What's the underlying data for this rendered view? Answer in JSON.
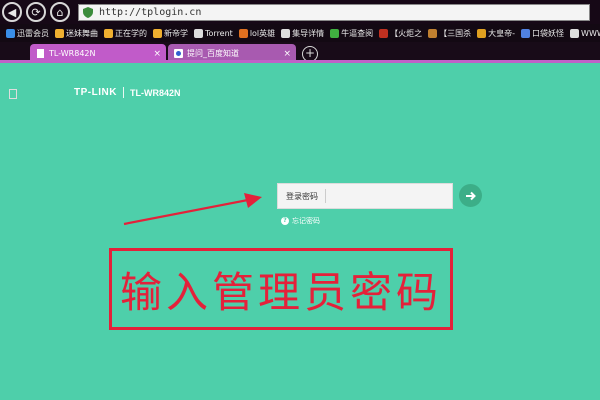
{
  "browser": {
    "url": "http://tplogin.cn",
    "bookmarks": [
      {
        "label": "迅雷会员",
        "color": "#3a8ee8"
      },
      {
        "label": "迷妹舞曲",
        "color": "#f0b030"
      },
      {
        "label": "正在学的",
        "color": "#f0b030"
      },
      {
        "label": "新帝学",
        "color": "#f0b030"
      },
      {
        "label": "Torrent",
        "color": "#dddddd"
      },
      {
        "label": "lol英雄",
        "color": "#e07020"
      },
      {
        "label": "集导详情",
        "color": "#dddddd"
      },
      {
        "label": "牛逼查阅",
        "color": "#40b040"
      },
      {
        "label": "【火炬之",
        "color": "#c03020"
      },
      {
        "label": "【三国杀",
        "color": "#c08030"
      },
      {
        "label": "大皇帝-",
        "color": "#e0a020"
      },
      {
        "label": "口袋妖怪",
        "color": "#5080e0"
      },
      {
        "label": "WWW.",
        "color": "#dddddd"
      }
    ],
    "tabs": [
      {
        "label": "TL-WR842N",
        "close": "×"
      },
      {
        "label": "提问_百度知道",
        "close": "×"
      }
    ],
    "new_tab": "+"
  },
  "page": {
    "brand": "TP-LINK",
    "model": "TL-WR842N",
    "password_label": "登录密码",
    "password_value": "",
    "forgot_label": "忘记密码",
    "forgot_icon": "?",
    "annotation": "输入管理员密码",
    "accent": "#e4213a",
    "background": "#4ecfaa"
  }
}
